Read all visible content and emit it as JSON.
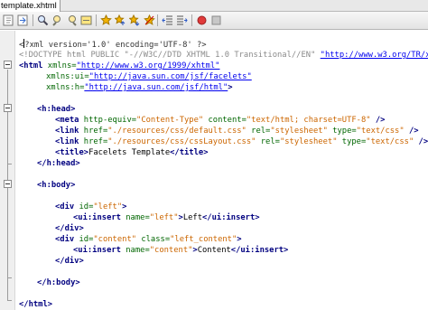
{
  "tab": {
    "label": "template.xhtml"
  },
  "toolbar": {
    "icons": [
      "nav-back-icon",
      "nav-forward-icon",
      "search-icon",
      "find-previous-icon",
      "find-next-icon",
      "toggle-highlight-icon",
      "toggle-bookmark-icon",
      "prev-bookmark-icon",
      "next-bookmark-icon",
      "shift-left-icon",
      "shift-right-icon",
      "record-macro-icon",
      "stop-macro-icon"
    ]
  },
  "code": {
    "l1": {
      "a": "?xml version='1.0' encoding='UTF-8' ?>"
    },
    "l2": {
      "a": "<!DOCTYPE html PUBLIC \"-//W3C//DTD XHTML 1.0 Transitional//EN\" ",
      "b": "\"http://www.w3.org/TR/xh"
    },
    "l3": {
      "a": "<html",
      "b": " xmlns=",
      "c": "\"http://www.w3.org/1999/xhtml\""
    },
    "l4": {
      "a": "xmlns:ui=",
      "b": "\"http://java.sun.com/jsf/facelets\""
    },
    "l5": {
      "a": "xmlns:h=",
      "b": "\"http://java.sun.com/jsf/html\"",
      "c": ">"
    },
    "l6": {
      "a": "<h:head>"
    },
    "l7": {
      "a": "<meta",
      "b": " http-equiv=",
      "c": "\"Content-Type\"",
      "d": " content=",
      "e": "\"text/html; charset=UTF-8\"",
      "f": " />"
    },
    "l8": {
      "a": "<link",
      "b": " href=",
      "c": "\"./resources/css/default.css\"",
      "d": " rel=",
      "e": "\"stylesheet\"",
      "f": " type=",
      "g": "\"text/css\"",
      "h": " />"
    },
    "l9": {
      "a": "<link",
      "b": " href=",
      "c": "\"./resources/css/cssLayout.css\"",
      "d": " rel=",
      "e": "\"stylesheet\"",
      "f": " type=",
      "g": "\"text/css\"",
      "h": " />"
    },
    "l10": {
      "a": "<title>",
      "b": "Facelets Template",
      "c": "</title>"
    },
    "l11": {
      "a": "</h:head>"
    },
    "l12": {
      "a": "<h:body>"
    },
    "l13": {
      "a": "<div",
      "b": " id=",
      "c": "\"left\"",
      "d": ">"
    },
    "l14": {
      "a": "<ui:insert",
      "b": " name=",
      "c": "\"left\"",
      "d": ">",
      "e": "Left",
      "f": "</ui:insert>"
    },
    "l15": {
      "a": "</div>"
    },
    "l16": {
      "a": "<div",
      "b": " id=",
      "c": "\"content\"",
      "d": " class=",
      "e": "\"left_content\"",
      "f": ">"
    },
    "l17": {
      "a": "<ui:insert",
      "b": " name=",
      "c": "\"content\"",
      "d": ">",
      "e": "Content",
      "f": "</ui:insert>"
    },
    "l18": {
      "a": "</div>"
    },
    "l19": {
      "a": "</h:body>"
    },
    "l20": {
      "a": "</html>"
    }
  }
}
